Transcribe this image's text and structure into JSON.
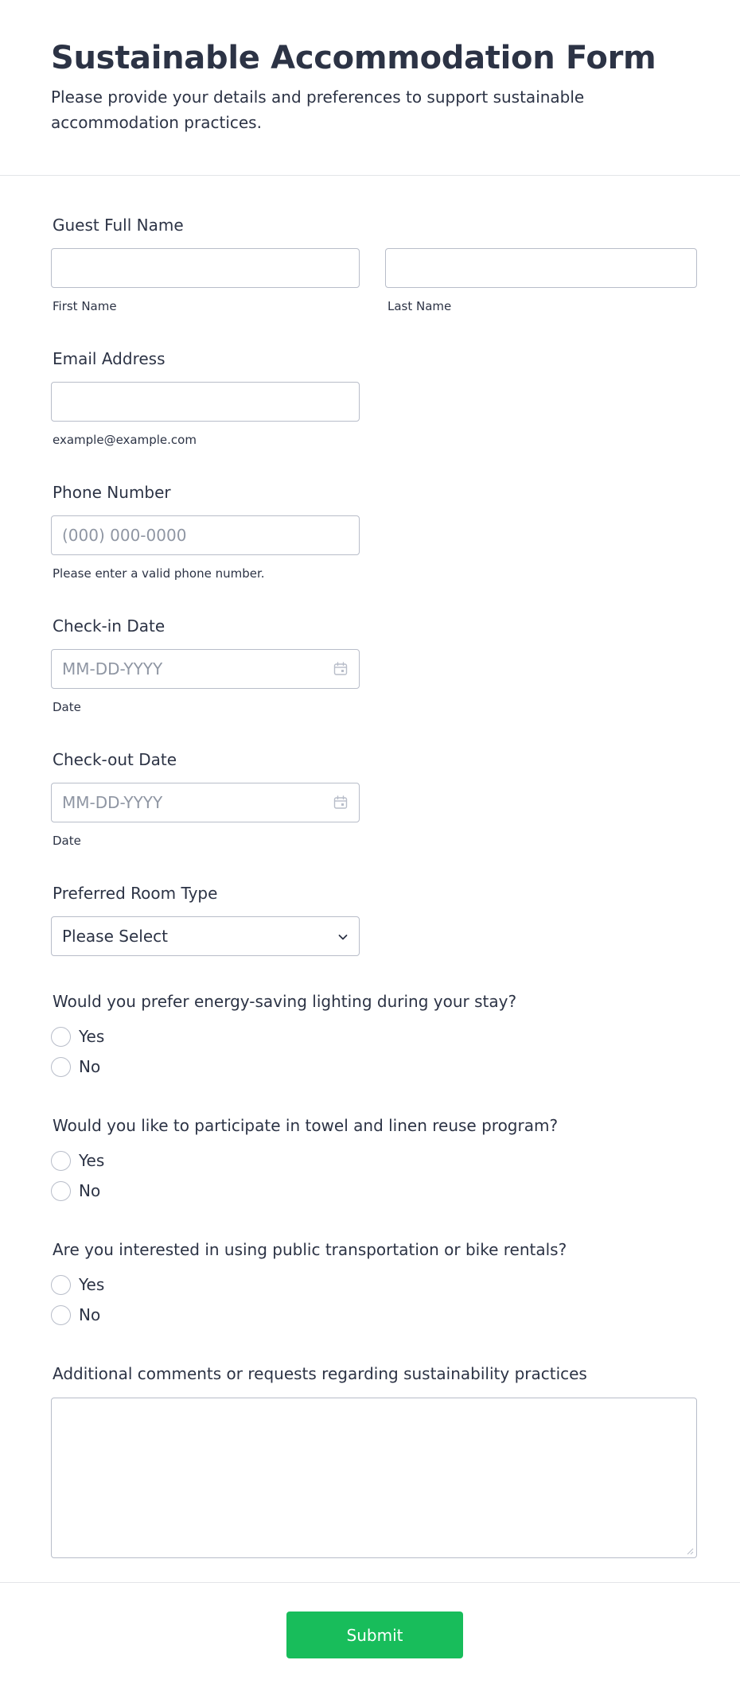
{
  "header": {
    "title": "Sustainable Accommodation Form",
    "subtitle": "Please provide your details and preferences to support sustainable accommodation practices."
  },
  "fields": {
    "name": {
      "label": "Guest Full Name",
      "first_sublabel": "First Name",
      "last_sublabel": "Last Name"
    },
    "email": {
      "label": "Email Address",
      "sublabel": "example@example.com"
    },
    "phone": {
      "label": "Phone Number",
      "placeholder": "(000) 000-0000",
      "sublabel": "Please enter a valid phone number."
    },
    "checkin": {
      "label": "Check-in Date",
      "placeholder": "MM-DD-YYYY",
      "sublabel": "Date",
      "icon": "calendar-icon"
    },
    "checkout": {
      "label": "Check-out Date",
      "placeholder": "MM-DD-YYYY",
      "sublabel": "Date",
      "icon": "calendar-icon"
    },
    "room": {
      "label": "Preferred Room Type",
      "selected": "Please Select",
      "icon": "chevron-down-icon"
    },
    "lighting": {
      "label": "Would you prefer energy-saving lighting during your stay?",
      "options": [
        "Yes",
        "No"
      ]
    },
    "towel": {
      "label": "Would you like to participate in towel and linen reuse program?",
      "options": [
        "Yes",
        "No"
      ]
    },
    "transport": {
      "label": "Are you interested in using public transportation or bike rentals?",
      "options": [
        "Yes",
        "No"
      ]
    },
    "comments": {
      "label": "Additional comments or requests regarding sustainability practices"
    }
  },
  "submit": {
    "label": "Submit",
    "color": "#18bd5b"
  },
  "colors": {
    "text": "#2c3345",
    "border": "#b8bdc9",
    "placeholder": "#8f96a3",
    "divider": "#e3e5e8"
  }
}
